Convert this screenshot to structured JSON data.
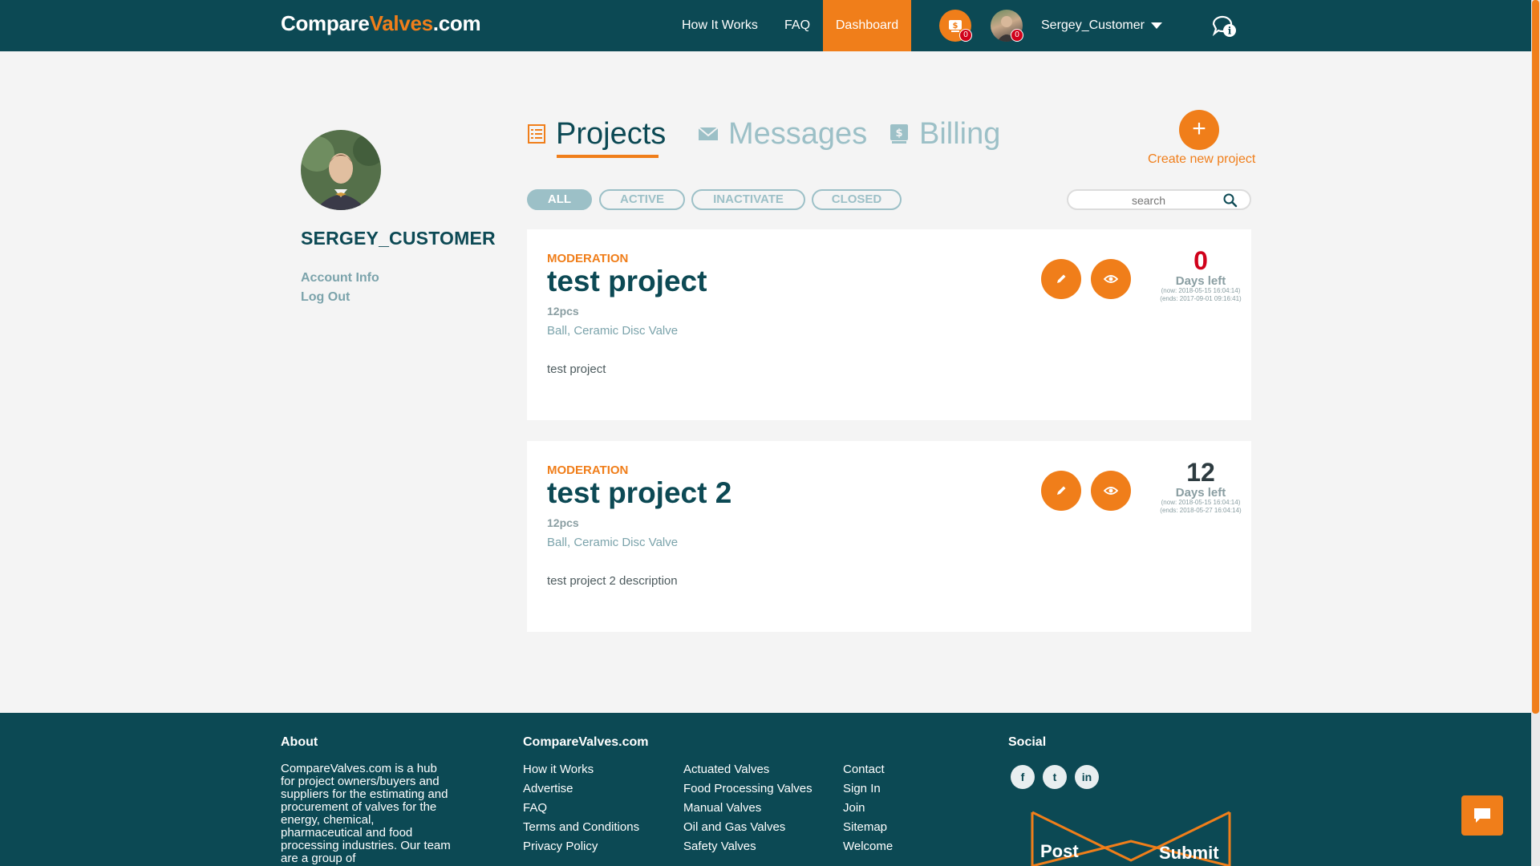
{
  "header": {
    "logo_part1": "Compare",
    "logo_part2": "Valves",
    "logo_part3": ".com",
    "nav": [
      "How It Works",
      "FAQ",
      "Dashboard"
    ],
    "billing_badge": "0",
    "avatar_badge": "0",
    "username": "Sergey_Customer"
  },
  "sidebar": {
    "username": "SERGEY_CUSTOMER",
    "account_info": "Account Info",
    "log_out": "Log Out"
  },
  "tabs": [
    "Projects",
    "Messages",
    "Billing"
  ],
  "create": {
    "plus": "+",
    "label": "Create new project"
  },
  "filters": [
    "ALL",
    "ACTIVE",
    "INACTIVATE",
    "CLOSED"
  ],
  "search": {
    "placeholder": "search"
  },
  "projects": [
    {
      "status": "MODERATION",
      "title": "test project",
      "qty": "12pcs",
      "types": "Ball, Ceramic Disc Valve",
      "description": "test project",
      "days": "0",
      "days_label": "Days left",
      "now": "(now: 2018-05-15 16:04:14)",
      "ends": "(ends: 2017-09-01 09:16:41)",
      "days_color": "#d0021b"
    },
    {
      "status": "MODERATION",
      "title": "test project 2",
      "qty": "12pcs",
      "types": "Ball, Ceramic Disc Valve",
      "description": "test project 2 description",
      "days": "12",
      "days_label": "Days left",
      "now": "(now: 2018-05-15 16:04:14)",
      "ends": "(ends: 2018-05-27 16:04:14)",
      "days_color": "#2d3b40"
    }
  ],
  "footer": {
    "about_title": "About",
    "about_text": "CompareValves.com is a hub for project owners/buyers and suppliers for the estimating and procurement of valves for the energy, chemical, pharmaceutical and food processing industries. Our team are a group of",
    "site_title": "CompareValves.com",
    "col1": [
      "How it Works",
      "Advertise",
      "FAQ",
      "Terms and Conditions",
      "Privacy Policy"
    ],
    "col2": [
      "Actuated Valves",
      "Food Processing Valves",
      "Manual Valves",
      "Oil and Gas Valves",
      "Safety Valves"
    ],
    "col3": [
      "Contact",
      "Sign In",
      "Join",
      "Sitemap",
      "Welcome"
    ],
    "social_title": "Social",
    "social": [
      "f",
      "t",
      "in"
    ],
    "banner_left": "Post",
    "banner_right": "Submit"
  },
  "colors": {
    "brand_dark": "#0c4954",
    "accent": "#f07e1a",
    "muted": "#9cc0c7",
    "badge": "#d0021b"
  }
}
